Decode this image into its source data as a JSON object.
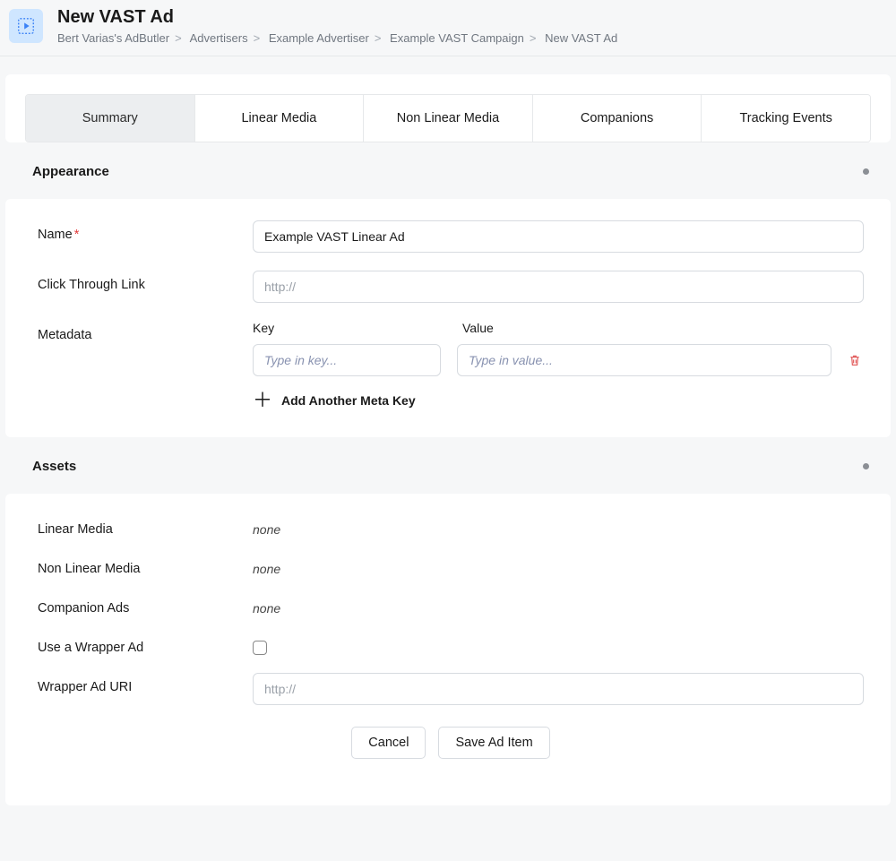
{
  "header": {
    "title": "New VAST Ad",
    "breadcrumb": [
      "Bert Varias's AdButler",
      "Advertisers",
      "Example Advertiser",
      "Example VAST Campaign",
      "New VAST Ad"
    ]
  },
  "tabs": [
    "Summary",
    "Linear Media",
    "Non Linear Media",
    "Companions",
    "Tracking Events"
  ],
  "sections": {
    "appearance": {
      "title": "Appearance",
      "name_label": "Name",
      "name_value": "Example VAST Linear Ad",
      "ctl_label": "Click Through Link",
      "ctl_placeholder": "http://",
      "metadata_label": "Metadata",
      "key_head": "Key",
      "value_head": "Value",
      "key_placeholder": "Type in key...",
      "value_placeholder": "Type in value...",
      "add_meta": "Add Another Meta Key"
    },
    "assets": {
      "title": "Assets",
      "linear_label": "Linear Media",
      "linear_value": "none",
      "nonlinear_label": "Non Linear Media",
      "nonlinear_value": "none",
      "companion_label": "Companion Ads",
      "companion_value": "none",
      "wrapper_chk_label": "Use a Wrapper Ad",
      "wrapper_uri_label": "Wrapper Ad URI",
      "wrapper_uri_placeholder": "http://"
    }
  },
  "buttons": {
    "cancel": "Cancel",
    "save": "Save Ad Item"
  }
}
